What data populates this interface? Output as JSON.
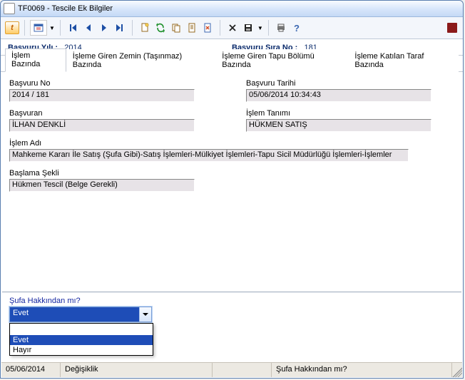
{
  "window": {
    "title": "TF0069 - Tescile Ek Bilgiler"
  },
  "summary": {
    "year_label": "Başvuru Yılı :",
    "year_value": "2014",
    "seq_label": "Başvuru Sıra No :",
    "seq_value": "181"
  },
  "tabs": [
    {
      "label": "İşlem Bazında"
    },
    {
      "label": "İşleme Giren Zemin (Taşınmaz) Bazında"
    },
    {
      "label": "İşleme Giren Tapu Bölümü Bazında"
    },
    {
      "label": "İşleme Katılan Taraf Bazında"
    }
  ],
  "fields": {
    "basvuru_no_lbl": "Başvuru No",
    "basvuru_no_val": "2014 / 181",
    "basvuru_tarihi_lbl": "Başvuru Tarihi",
    "basvuru_tarihi_val": "05/06/2014 10:34:43",
    "basvuran_lbl": "Başvuran",
    "basvuran_val": "İLHAN DENKLİ",
    "islem_tanimi_lbl": "İşlem Tanımı",
    "islem_tanimi_val": "HÜKMEN SATIŞ",
    "islem_adi_lbl": "İşlem Adı",
    "islem_adi_val": "Mahkeme Kararı İle Satış (Şufa Gibi)-Satış İşlemleri-Mülkiyet İşlemleri-Tapu Sicil Müdürlüğü İşlemleri-İşlemler",
    "baslama_sekli_lbl": "Başlama Şekli",
    "baslama_sekli_val": "Hükmen Tescil (Belge Gerekli)"
  },
  "question": {
    "label": "Şufa Hakkından mı?",
    "selected": "Evet",
    "options": [
      "",
      "Evet",
      "Hayır"
    ]
  },
  "status": {
    "date": "05/06/2014",
    "mode": "Değişiklik",
    "hint": "Şufa Hakkından mı?"
  }
}
